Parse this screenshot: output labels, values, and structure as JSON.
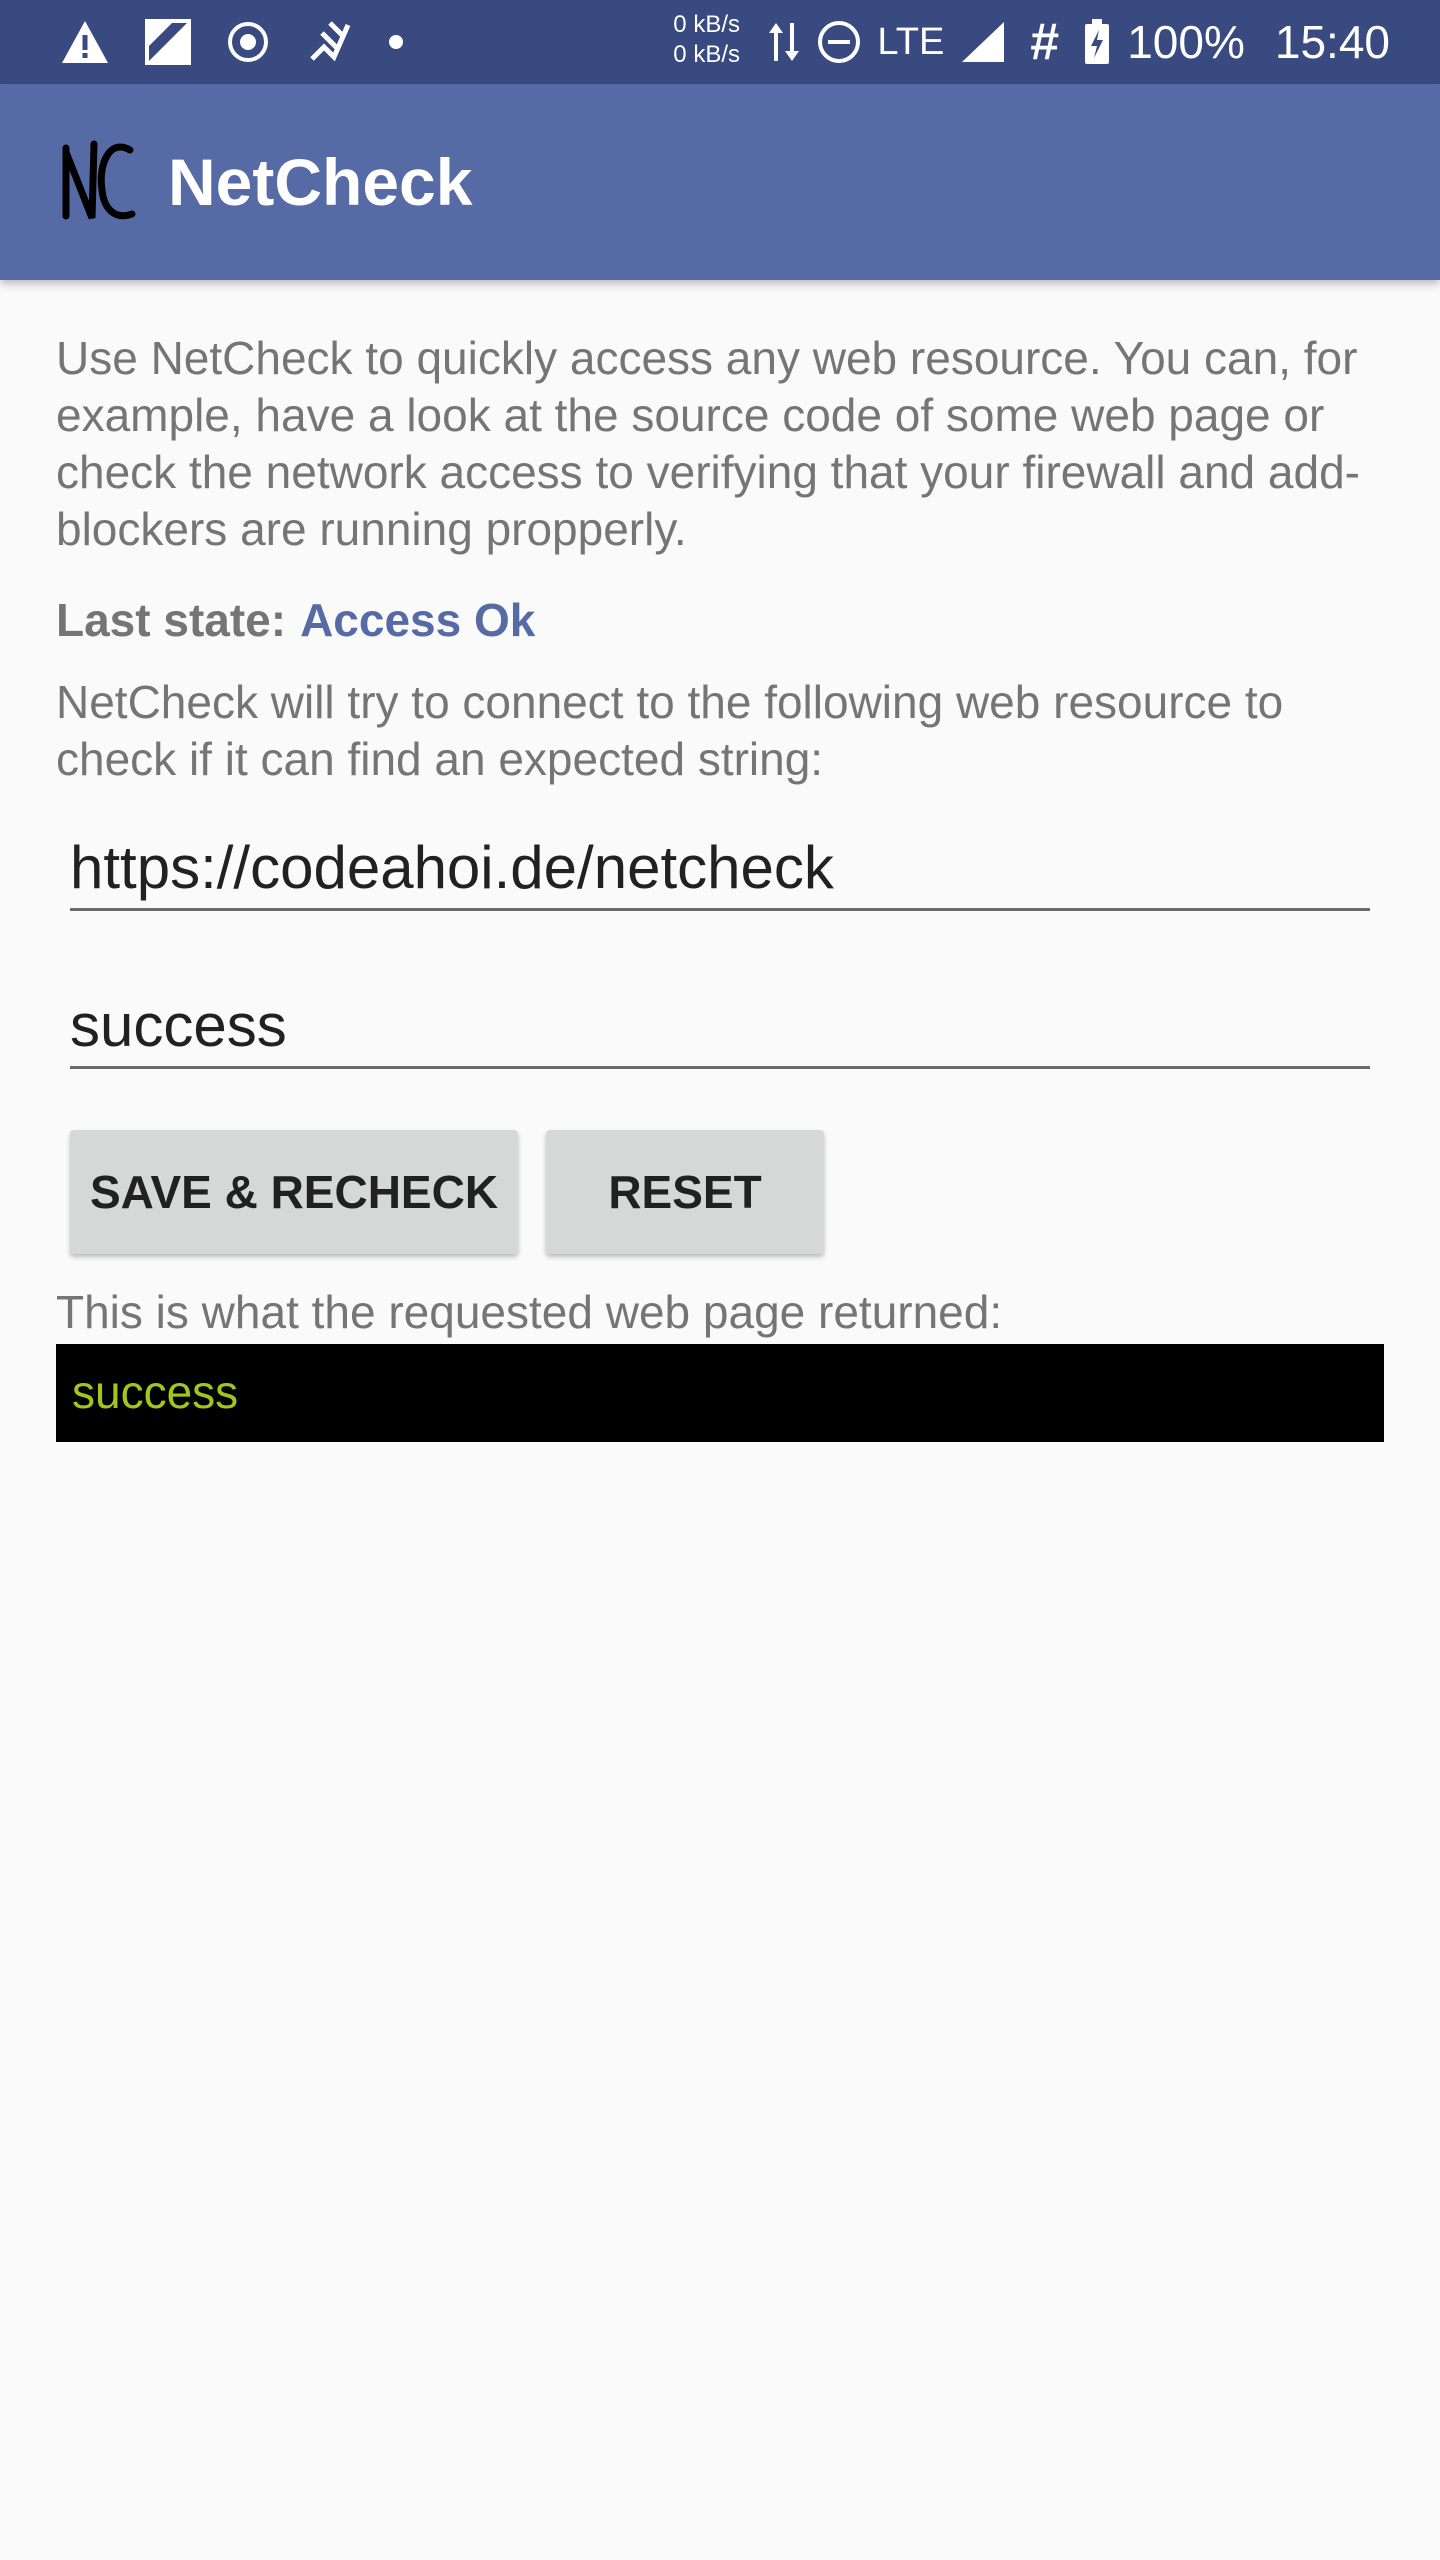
{
  "status_bar": {
    "icons_left": [
      "warning-icon",
      "sim-icon",
      "target-icon",
      "power-icon",
      "dot-icon"
    ],
    "speed_up": "0 kB/s",
    "speed_down": "0 kB/s",
    "network": "LTE",
    "hash": "#",
    "battery": "100%",
    "time": "15:40"
  },
  "app_bar": {
    "title": "NetCheck",
    "logo_text": "NC"
  },
  "main": {
    "intro": "Use NetCheck to quickly access any web resource. You can, for example, have a look at the source code of some web page or check the network access to verifying that your firewall and add-blockers are running propperly.",
    "last_state_label": "Last state:",
    "last_state_value": "Access Ok",
    "connect_text": "NetCheck will try to connect to the following web resource to check if it can find an expected string:",
    "url_value": "https://codeahoi.de/netcheck",
    "expected_string_value": "success",
    "save_button_label": "SAVE & RECHECK",
    "reset_button_label": "RESET",
    "returned_label": "This is what the requested web page returned:",
    "returned_value": "success"
  },
  "colors": {
    "status_bar": "#394a80",
    "app_bar": "#566ba6",
    "accent": "#566ba6",
    "result_text": "#a4c61a",
    "result_background": "#000000",
    "button": "#d6d7d7"
  }
}
